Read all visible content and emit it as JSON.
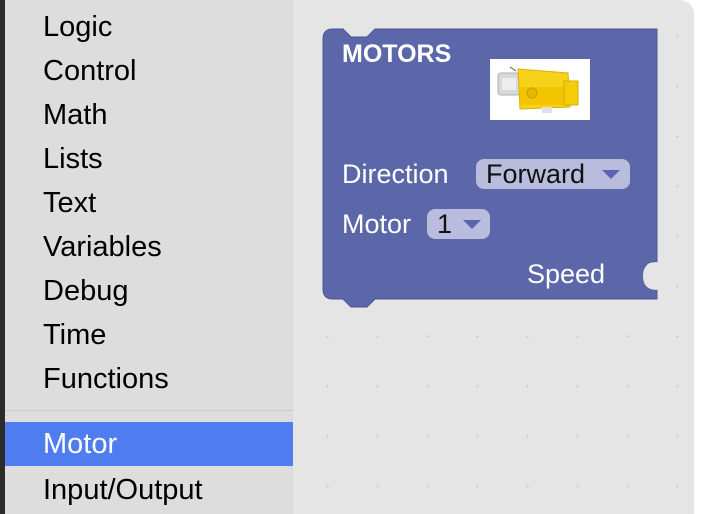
{
  "toolbox": {
    "categories": [
      {
        "label": "Logic"
      },
      {
        "label": "Control"
      },
      {
        "label": "Math"
      },
      {
        "label": "Lists"
      },
      {
        "label": "Text"
      },
      {
        "label": "Variables"
      },
      {
        "label": "Debug"
      },
      {
        "label": "Time"
      },
      {
        "label": "Functions"
      }
    ],
    "extra_categories": [
      {
        "label": "Motor",
        "selected": true
      },
      {
        "label": "Input/Output",
        "selected": false
      }
    ]
  },
  "block": {
    "title": "MOTORS",
    "color": "#5b67a8",
    "direction_label": "Direction",
    "direction_value": "Forward",
    "motor_label": "Motor",
    "motor_value": "1",
    "speed_label": "Speed",
    "image_icon": "dc-gear-motor-icon"
  },
  "colors": {
    "selected_category": "#4f7cee",
    "toolbox_bg": "#dddddd",
    "workspace_bg": "#e5e5e5",
    "dropdown_bg": "#b9bcdc"
  }
}
